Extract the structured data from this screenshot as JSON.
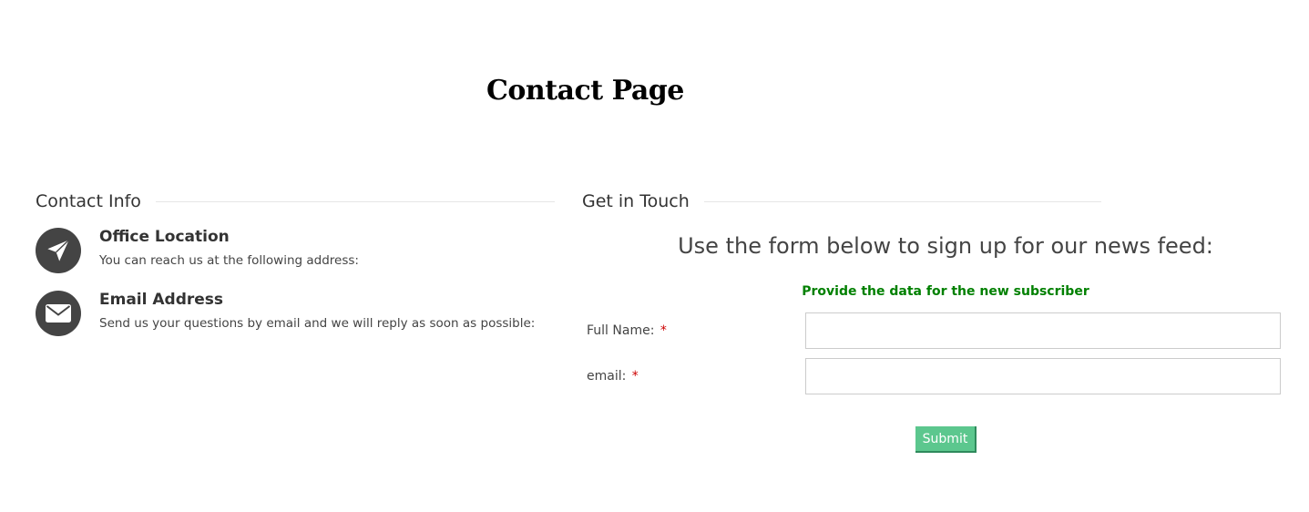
{
  "page": {
    "title": "Contact Page"
  },
  "contact_info": {
    "heading": "Contact Info",
    "items": [
      {
        "icon": "paper-plane-icon",
        "title": "Office Location",
        "description": "You can reach us at the following address:"
      },
      {
        "icon": "envelope-icon",
        "title": "Email Address",
        "description": "Send us your questions by email and we will reply as soon as possible:"
      }
    ]
  },
  "get_in_touch": {
    "heading": "Get in Touch",
    "intro": "Use the form below to sign up for our news feed:",
    "subintro": "Provide the data for the new subscriber",
    "fields": [
      {
        "label": "Full Name:",
        "required_mark": "*",
        "value": "",
        "placeholder": ""
      },
      {
        "label": "email:",
        "required_mark": "*",
        "value": "",
        "placeholder": ""
      }
    ],
    "submit_label": "Submit"
  },
  "colors": {
    "icon_circle": "#444444",
    "subintro_green": "#008000",
    "required_red": "#cc0000",
    "submit_green": "#5cc78e"
  }
}
